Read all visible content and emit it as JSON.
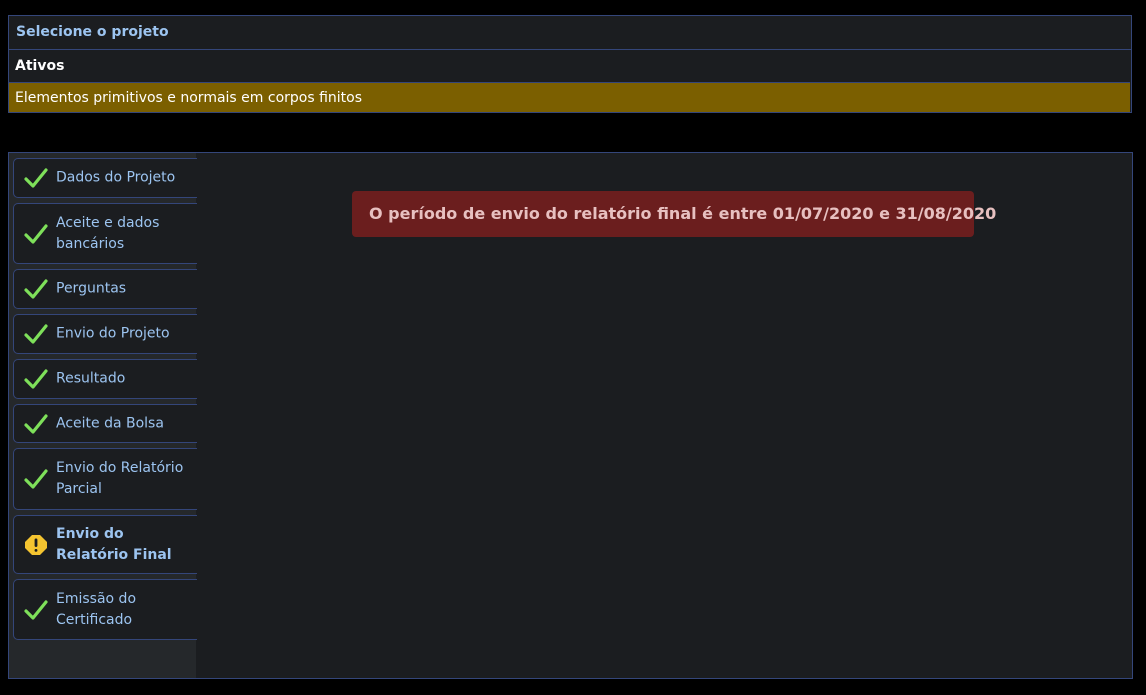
{
  "select_panel": {
    "title": "Selecione o projeto",
    "group_label": "Ativos",
    "project": "Elementos primitivos e normais em corpos finitos"
  },
  "steps": [
    {
      "label": "Dados do Projeto",
      "status": "check-icon"
    },
    {
      "label": "Aceite e dados bancários",
      "status": "check-icon"
    },
    {
      "label": "Perguntas",
      "status": "check-icon"
    },
    {
      "label": "Envio do Projeto",
      "status": "check-icon"
    },
    {
      "label": "Resultado",
      "status": "check-icon"
    },
    {
      "label": "Aceite da Bolsa",
      "status": "check-icon"
    },
    {
      "label": "Envio do Relatório Parcial",
      "status": "check-icon"
    },
    {
      "label": "Envio do Relatório Final",
      "status": "warning-icon"
    },
    {
      "label": "Emissão do Certificado",
      "status": "check-icon"
    }
  ],
  "alert": {
    "message": "O período de envio do relatório final é entre 01/07/2020 e 31/08/2020"
  },
  "colors": {
    "accent_text": "#9cc4f0",
    "selected_project": "#7b5f00",
    "alert_bg": "#6b1e1e",
    "check": "#7ee05a",
    "warning": "#f4c430"
  }
}
